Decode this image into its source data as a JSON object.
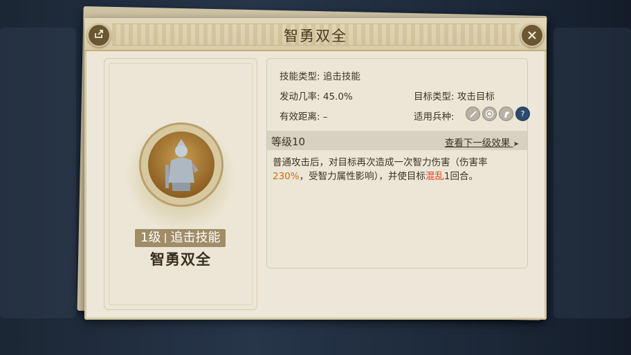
{
  "window": {
    "title": "智勇双全"
  },
  "skill": {
    "level_label": "1级",
    "type_label": "追击技能",
    "name": "智勇双全"
  },
  "info": {
    "skill_type_label": "技能类型:",
    "skill_type_value": "追击技能",
    "trigger_rate_label": "发动几率:",
    "trigger_rate_value": "45.0%",
    "target_type_label": "目标类型:",
    "target_type_value": "攻击目标",
    "range_label": "有效距离:",
    "range_value": "–",
    "unit_label": "适用兵种:",
    "unit_icons": [
      "sword-icon",
      "target-icon",
      "horse-icon",
      "help-icon"
    ]
  },
  "level_section": {
    "level": "等级10",
    "next_link": "查看下一级效果",
    "next_arrow": "➤"
  },
  "description": {
    "part1": "普通攻击后，对目标再次造成一次智力伤害（伤害率",
    "rate": "230%",
    "part2": "，受智力属性影响），并使目标",
    "status": "混乱",
    "part3": "1回合。"
  },
  "colors": {
    "accent_orange": "#d86a12",
    "accent_red": "#e2391f",
    "panel_bg": "#ece7d8"
  }
}
